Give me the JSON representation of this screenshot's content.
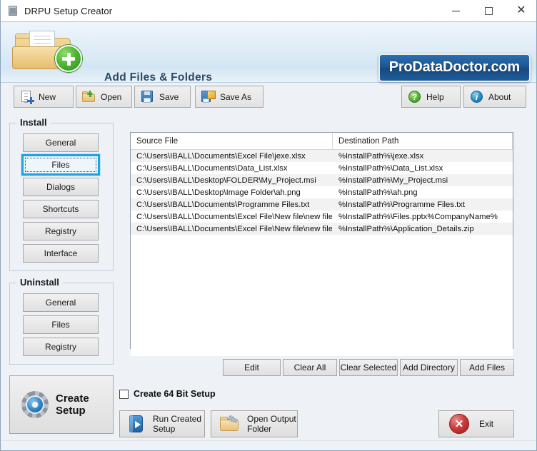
{
  "window": {
    "title": "DRPU Setup Creator",
    "icon": "app-icon",
    "controls": {
      "minimize": "minimize",
      "maximize": "maximize",
      "close": "close"
    }
  },
  "header": {
    "title": "Add Files & Folders",
    "brand": "ProDataDoctor.com",
    "logo_icon": "folder-add-icon"
  },
  "toolbar": {
    "buttons": [
      {
        "label": "New",
        "icon": "new-document-icon"
      },
      {
        "label": "Open",
        "icon": "open-folder-icon"
      },
      {
        "label": "Save",
        "icon": "floppy-save-icon"
      },
      {
        "label": "Save As",
        "icon": "floppy-pencil-icon"
      }
    ],
    "right_buttons": [
      {
        "label": "Help",
        "icon": "help-question-icon"
      },
      {
        "label": "About",
        "icon": "info-icon"
      }
    ]
  },
  "sidebar": {
    "install": {
      "title": "Install",
      "items": [
        {
          "label": "General",
          "selected": false
        },
        {
          "label": "Files",
          "selected": true
        },
        {
          "label": "Dialogs",
          "selected": false
        },
        {
          "label": "Shortcuts",
          "selected": false
        },
        {
          "label": "Registry",
          "selected": false
        },
        {
          "label": "Interface",
          "selected": false
        }
      ]
    },
    "uninstall": {
      "title": "Uninstall",
      "items": [
        {
          "label": "General"
        },
        {
          "label": "Files"
        },
        {
          "label": "Registry"
        }
      ]
    },
    "create_setup": {
      "line1": "Create",
      "line2": "Setup",
      "icon": "gear-icon"
    }
  },
  "file_table": {
    "columns": [
      "Source File",
      "Destination Path"
    ],
    "rows": [
      {
        "source": "C:\\Users\\IBALL\\Documents\\Excel File\\jexe.xlsx",
        "destination": "%InstallPath%\\jexe.xlsx"
      },
      {
        "source": "C:\\Users\\IBALL\\Documents\\Data_List.xlsx",
        "destination": "%InstallPath%\\Data_List.xlsx"
      },
      {
        "source": "C:\\Users\\IBALL\\Desktop\\FOLDER\\My_Project.msi",
        "destination": "%InstallPath%\\My_Project.msi"
      },
      {
        "source": "C:\\Users\\IBALL\\Desktop\\Image Folder\\ah.png",
        "destination": "%InstallPath%\\ah.png"
      },
      {
        "source": "C:\\Users\\IBALL\\Documents\\Programme Files.txt",
        "destination": "%InstallPath%\\Programme Files.txt"
      },
      {
        "source": "C:\\Users\\IBALL\\Documents\\Excel File\\New file\\new file\\...",
        "destination": "%InstallPath%\\Files.pptx%CompanyName%"
      },
      {
        "source": "C:\\Users\\IBALL\\Documents\\Excel File\\New file\\new file\\...",
        "destination": "%InstallPath%\\Application_Details.zip"
      }
    ],
    "empty_rows": 10
  },
  "table_actions": [
    {
      "label": "Edit"
    },
    {
      "label": "Clear All"
    },
    {
      "label": "Clear Selected"
    },
    {
      "label": "Add Directory"
    },
    {
      "label": "Add Files"
    }
  ],
  "options": {
    "create_64bit": {
      "label": "Create 64 Bit Setup",
      "checked": false
    }
  },
  "bottom_actions": {
    "run_created_setup": {
      "line1": "Run Created",
      "line2": "Setup",
      "icon": "run-setup-icon"
    },
    "open_output_folder": {
      "line1": "Open Output",
      "line2": "Folder",
      "icon": "output-folder-icon"
    },
    "exit": {
      "label": "Exit",
      "icon": "exit-x-icon"
    }
  },
  "colors": {
    "accent_blue": "#1fa4e8",
    "brand_blue": "#1d558f",
    "panel_bg": "#eef1f5",
    "green": "#4fb933",
    "red": "#cc3b3b"
  }
}
